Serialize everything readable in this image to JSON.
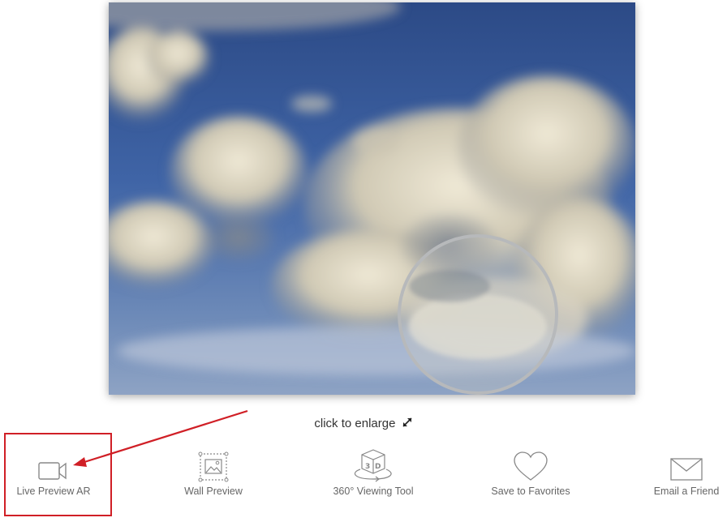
{
  "painting": {
    "alt_label": "cloudy sky painting"
  },
  "enlarge": {
    "label": "click to enlarge",
    "icon": "expand-arrows-icon"
  },
  "tools": [
    {
      "label": "Live Preview AR",
      "icon": "video-camera-icon"
    },
    {
      "label": "Wall Preview",
      "icon": "wall-picture-icon"
    },
    {
      "label": "360° Viewing Tool",
      "icon": "cube-3d-icon"
    },
    {
      "label": "Save to Favorites",
      "icon": "heart-icon"
    },
    {
      "label": "Email a Friend",
      "icon": "envelope-icon"
    }
  ],
  "colors": {
    "annotation_red": "#d01f26",
    "icon_gray": "#888888"
  }
}
